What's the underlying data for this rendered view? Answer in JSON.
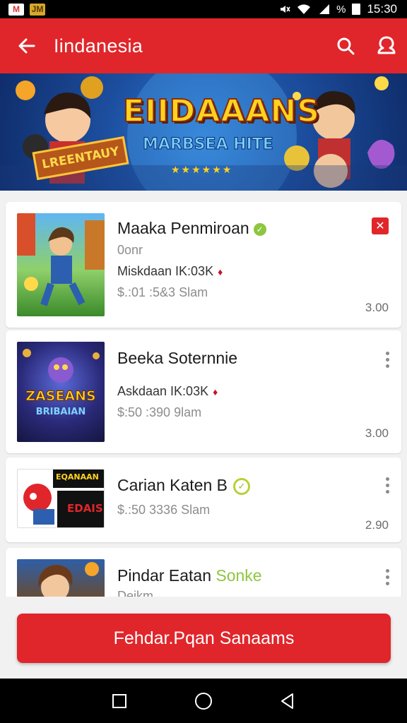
{
  "status": {
    "left_icons": [
      "gmail-icon",
      "app-icon"
    ],
    "battery_percent": "%",
    "time": "15:30"
  },
  "appbar": {
    "title": "Iindanesia",
    "icons": [
      "back-arrow-icon",
      "search-icon",
      "profile-icon"
    ]
  },
  "banner": {
    "title": "EIIDAAANS",
    "subtitle": "MARBSEA HITE",
    "plaque": "LREENTAUY"
  },
  "items": [
    {
      "title": "Maaka Penmiroan",
      "line1": "0onr",
      "line2": "Miskdaan IK:03K",
      "line3": "$.:01 :5&3 Slam",
      "number": "3.00",
      "thumb_text": "",
      "verified": true,
      "action": "flag"
    },
    {
      "title": "Beeka Soternnie",
      "line1": "Askdaan IK:03K",
      "line2": "$:50 :390 9lam",
      "number": "3.00",
      "thumb_text": "ZASEANS",
      "thumb_sub": "BRIBAIAN",
      "action": "more"
    },
    {
      "title": "Carian Katen B",
      "line1": "$.:50 3336 Slam",
      "number": "2.90",
      "thumb_text": "EQANAAN",
      "thumb_sub": "EDAIS",
      "verified": true,
      "action": "more"
    },
    {
      "title_part1": "Pindar Eatan",
      "title_part2": "Sonke",
      "line1": "Deikm",
      "action": "more"
    }
  ],
  "cta": {
    "label": "Fehdar.Pqan Sanaams"
  },
  "navbar": {
    "icons": [
      "recent-apps-icon",
      "home-icon",
      "back-icon"
    ]
  },
  "colors": {
    "primary": "#e0262b",
    "verified": "#8dc63f"
  }
}
